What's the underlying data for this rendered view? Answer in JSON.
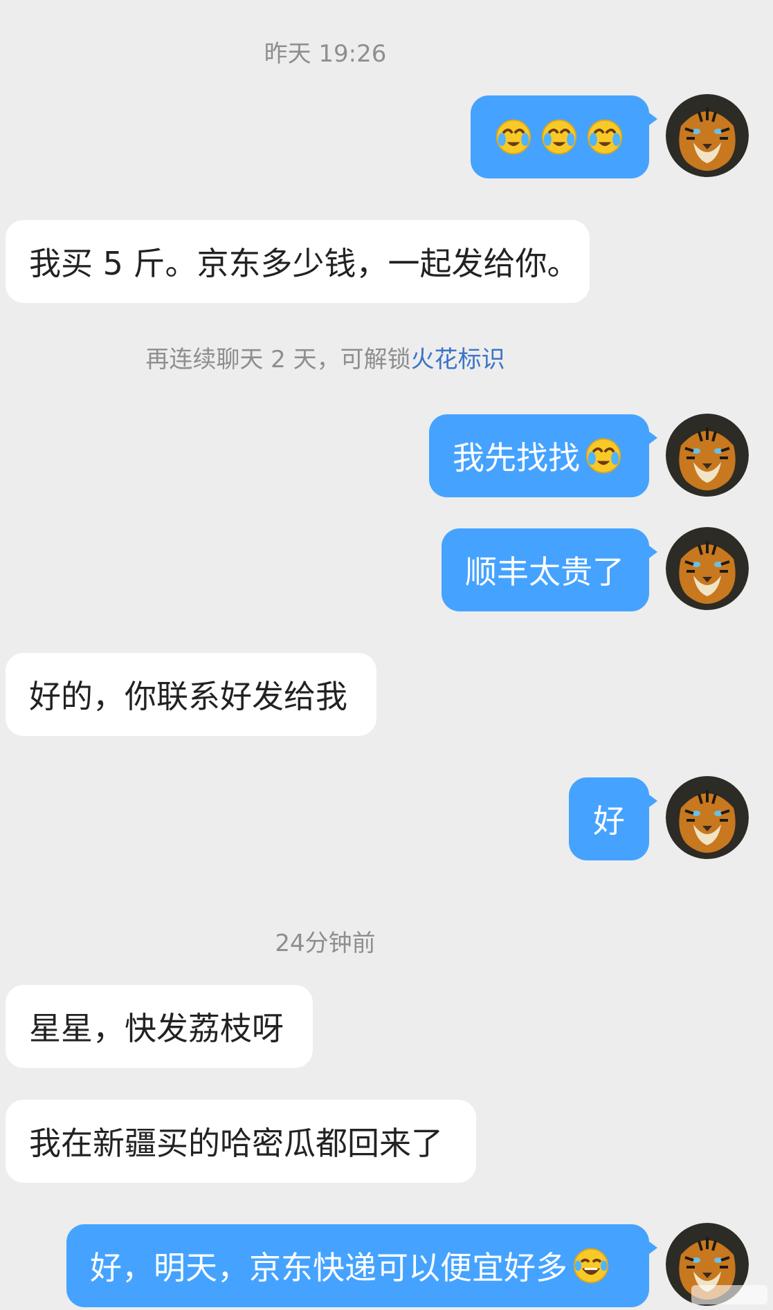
{
  "timestamps": {
    "first": "昨天 19:26",
    "second": "24分钟前"
  },
  "notice": {
    "text": "再连续聊天 2 天，可解锁",
    "link": "火花标识"
  },
  "messages": {
    "m2": "我买 5 斤。京东多少钱，一起发给你。",
    "m3": "我先找找",
    "m4": "顺丰太贵了",
    "m5": "好的，你联系好发给我",
    "m6": "好",
    "m7": "星星，快发荔枝呀",
    "m8": "我在新疆买的哈密瓜都回来了",
    "m9": "好，明天，京东快递可以便宜好多"
  },
  "icons": {
    "cry_laugh": "crying-laughing-emoji",
    "tears_joy": "tears-of-joy-emoji",
    "avatar": "tiger-avatar"
  },
  "colors": {
    "outgoing": "#45a3ff",
    "incoming": "#ffffff",
    "background": "#ededed",
    "link": "#3b74c9"
  }
}
